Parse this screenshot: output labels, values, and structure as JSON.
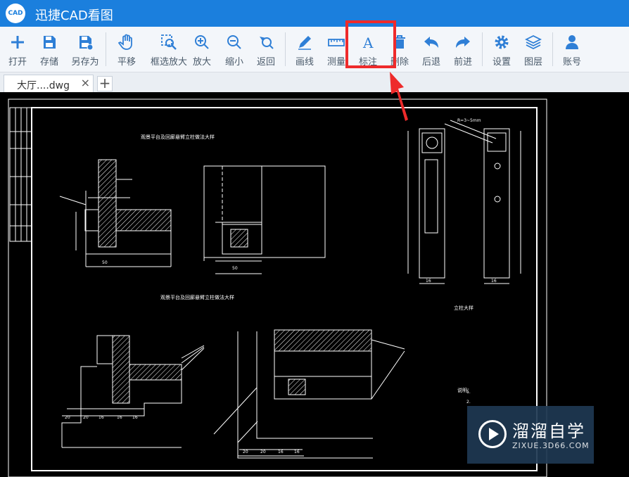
{
  "app": {
    "title": "迅捷CAD看图",
    "logo_text": "CAD"
  },
  "toolbar": {
    "open": "打开",
    "save": "存储",
    "save_as": "另存为",
    "pan": "平移",
    "box_zoom": "框选放大",
    "zoom_in": "放大",
    "zoom_out": "缩小",
    "back": "返回",
    "draw_line": "画线",
    "measure": "测量",
    "annotate": "标注",
    "delete": "删除",
    "undo": "后退",
    "redo": "前进",
    "settings": "设置",
    "layers": "图层",
    "account": "账号"
  },
  "tabs": {
    "file_name": "大厅....dwg",
    "close": "×",
    "add": "+"
  },
  "drawing": {
    "title1": "观景平台及回廊悬臂立柱做法大样",
    "title2": "观景平台及回廊悬臂立柱做法大样",
    "title3": "立柱大样",
    "note_label": "说明：",
    "dim_top": "R=3~5mm"
  },
  "watermark": {
    "brand": "溜溜自学",
    "url": "ZIXUE.3D66.COM"
  },
  "colors": {
    "titlebar": "#1b7fdd",
    "icon_blue": "#2f7fd6",
    "highlight": "#ee2b2b",
    "toolbar_bg": "#f3f6fa"
  }
}
